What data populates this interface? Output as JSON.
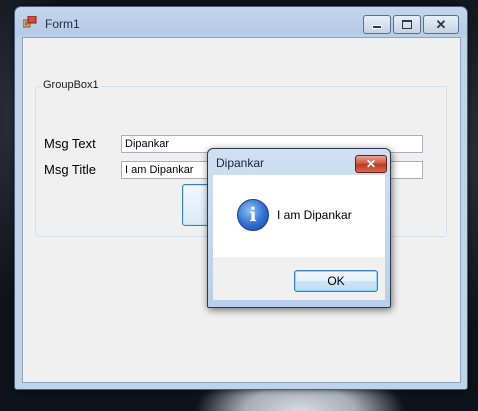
{
  "form": {
    "title": "Form1",
    "groupbox_label": "GroupBox1",
    "msg_text_label": "Msg Text",
    "msg_text_value": "Dipankar",
    "msg_title_label": "Msg Title",
    "msg_title_value": "I am Dipankar",
    "show_button_label": ""
  },
  "title_buttons": {
    "minimize": "minimize-icon",
    "maximize": "maximize-icon",
    "close": "close-icon"
  },
  "messagebox": {
    "title": "Dipankar",
    "message": "I am Dipankar",
    "ok_label": "OK",
    "icon": "information-icon"
  }
}
